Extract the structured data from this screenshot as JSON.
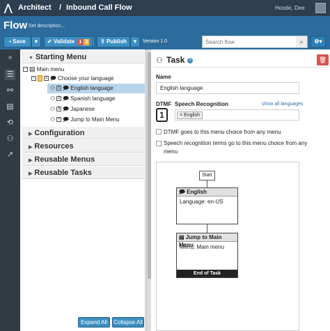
{
  "topbar": {
    "app_name": "Architect",
    "separator": "/",
    "section": "Inbound Call Flow",
    "user": "Hoode, Dee",
    "dropdown_arrow": "▾"
  },
  "flowbar": {
    "title": "Flow",
    "set_description": "Set description...",
    "save_label": "Save",
    "validate_label": "Validate",
    "validate_errors": "1",
    "validate_warnings": "2",
    "publish_label": "Publish",
    "version": "Version 1.0",
    "search_placeholder": "Search flow",
    "dropdown_arrow": "▾"
  },
  "tree": {
    "starting_menu": "Starting Menu",
    "main_menu": "Main menu",
    "choose_language": "Choose your language",
    "items": [
      "English language",
      "Spanish language",
      "Japanese",
      "Jump to Main Menu"
    ],
    "sections": [
      "Configuration",
      "Resources",
      "Reusable Menus",
      "Reusable Tasks"
    ],
    "expand_all": "Expand All",
    "collapse_all": "Collapse All",
    "node_box_1": "1",
    "node_box_2": "2",
    "node_box_3": "3",
    "node_box_x": "×"
  },
  "task": {
    "title": "Task",
    "help": "?",
    "name_label": "Name",
    "name_value": "English language",
    "dtmf_label": "DTMF",
    "dtmf_value": "1",
    "speech_label": "Speech Recognition",
    "show_all": "show all languages",
    "speech_tag": "English",
    "speech_tag_remove": "×",
    "checkbox1": "DTMF goes to this menu choice from any menu",
    "checkbox2": "Speech recognition terms go to this menu choice from any menu"
  },
  "flow": {
    "start": "Start",
    "english_header": "English",
    "english_body": "Language: en-US",
    "jump_header": "Jump to Main Menu",
    "jump_body": "Menu: Main menu",
    "end": "End of Task"
  }
}
